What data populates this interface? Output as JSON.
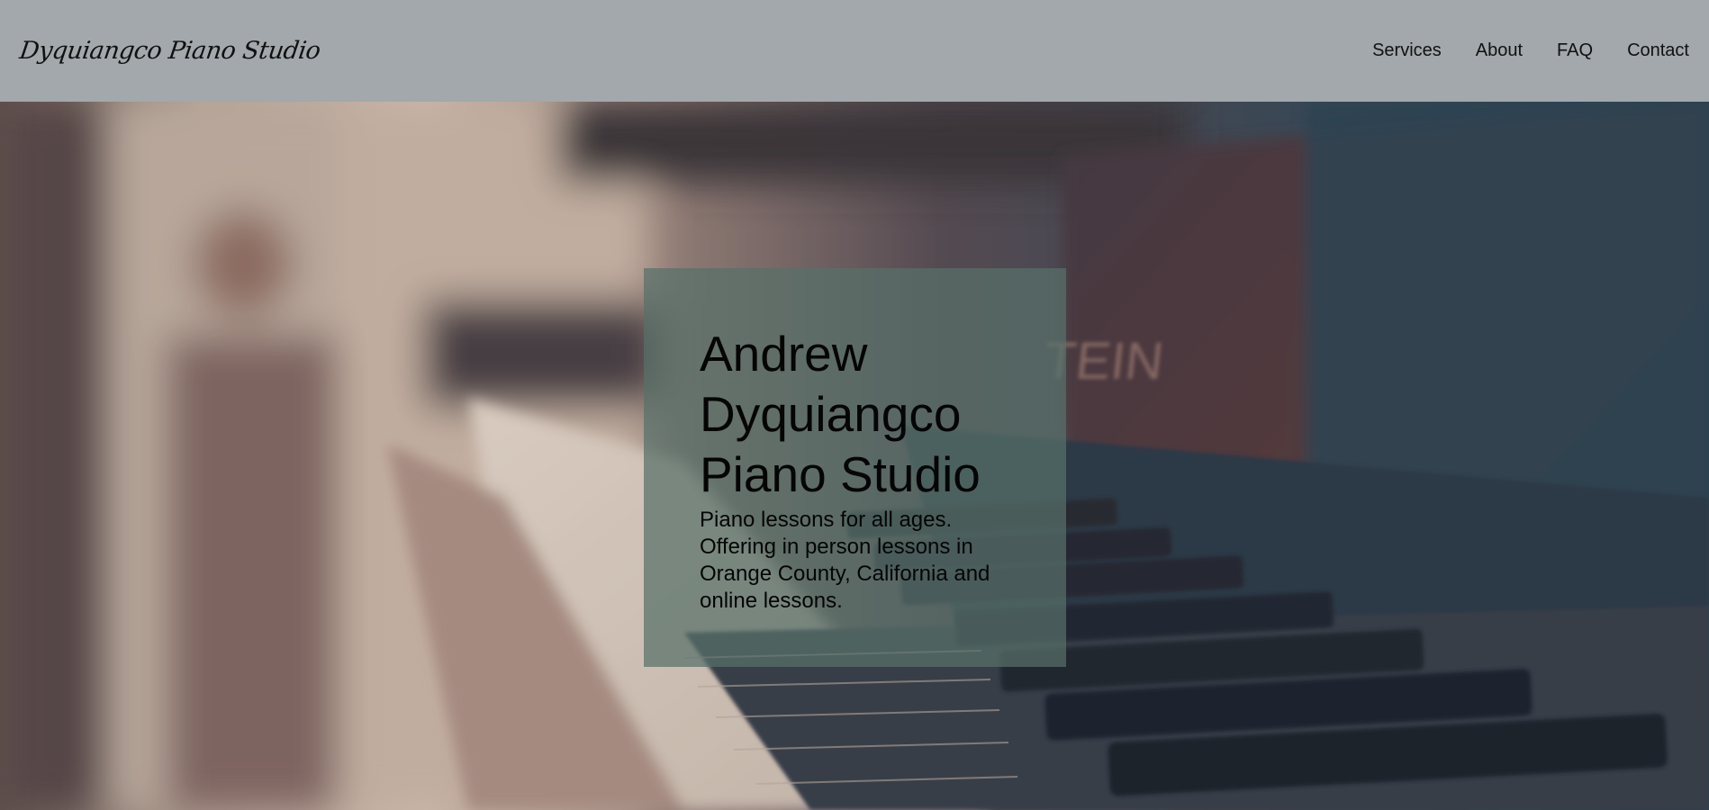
{
  "header": {
    "brand": "Dyquiangco Piano Studio",
    "nav": [
      {
        "label": "Services"
      },
      {
        "label": "About"
      },
      {
        "label": "FAQ"
      },
      {
        "label": "Contact"
      }
    ]
  },
  "hero": {
    "title": "Andrew Dyquiangco Piano Studio",
    "subtitle": "Piano lessons for all ages. Offering in person lessons in Orange County, California and online lessons.",
    "background_image": "blurred-piano-keys-photo",
    "piano_brand_fragment": "TEIN"
  },
  "colors": {
    "navbar_bg": "#a2a8ab",
    "card_bg": "#58706a",
    "text": "#050505"
  }
}
